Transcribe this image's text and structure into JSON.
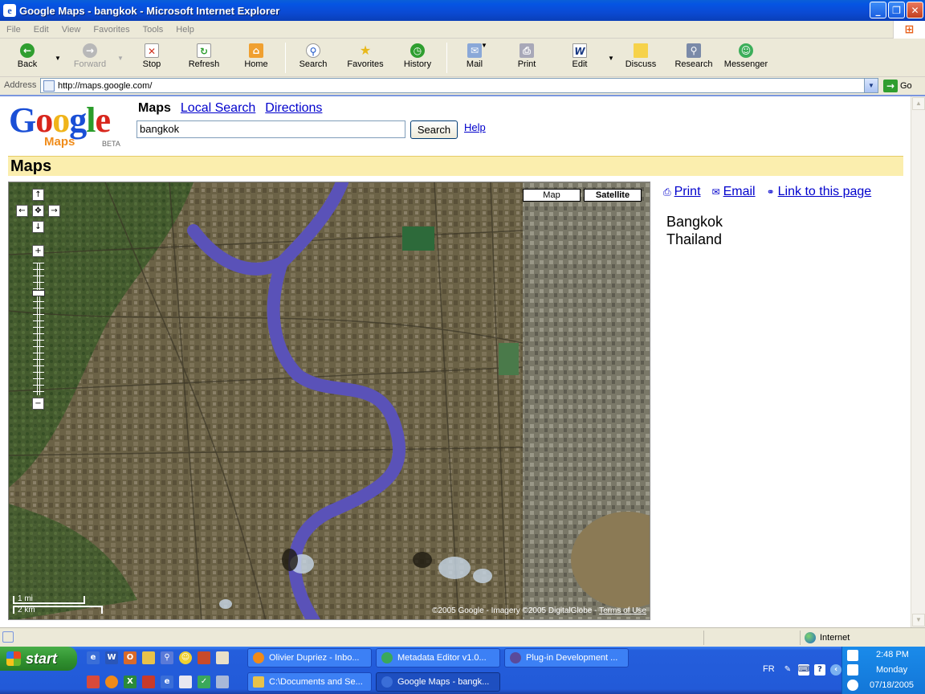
{
  "window": {
    "title": "Google Maps - bangkok - Microsoft Internet Explorer",
    "controls": {
      "minimize": "_",
      "restore": "❐",
      "close": "✕"
    }
  },
  "menu": [
    "File",
    "Edit",
    "View",
    "Favorites",
    "Tools",
    "Help"
  ],
  "toolbar": {
    "back": "Back",
    "forward": "Forward",
    "stop": "Stop",
    "refresh": "Refresh",
    "home": "Home",
    "search": "Search",
    "favorites": "Favorites",
    "history": "History",
    "mail": "Mail",
    "print": "Print",
    "edit": "Edit",
    "discuss": "Discuss",
    "research": "Research",
    "messenger": "Messenger"
  },
  "address": {
    "label": "Address",
    "url": "http://maps.google.com/",
    "go": "Go"
  },
  "page": {
    "logo": {
      "word": [
        "G",
        "o",
        "o",
        "g",
        "l",
        "e"
      ],
      "sub": "Maps",
      "beta": "BETA"
    },
    "nav": {
      "maps": "Maps",
      "local_search": "Local Search",
      "directions": "Directions"
    },
    "search": {
      "value": "bangkok",
      "button": "Search",
      "help": "Help"
    },
    "section_title": "Maps",
    "map": {
      "type_map": "Map",
      "type_satellite": "Satellite",
      "selected_type": "Satellite",
      "scale_mi": "1 mi",
      "scale_km": "2 km",
      "copyright": "©2005 Google - Imagery ©2005 DigitalGlobe -",
      "terms": "Terms of Use"
    },
    "actions": {
      "print": "Print",
      "email": "Email",
      "link": "Link to this page"
    },
    "place": {
      "city": "Bangkok",
      "country": "Thailand"
    }
  },
  "statusbar": {
    "zone": "Internet"
  },
  "taskbar": {
    "start": "start",
    "tasks_top": [
      "Olivier Dupriez - Inbo...",
      "Metadata Editor v1.0...",
      "Plug-in Development ..."
    ],
    "tasks_bottom": [
      "C:\\Documents and Se...",
      "Google Maps - bangk..."
    ],
    "lang": "FR",
    "time": "2:48 PM",
    "day": "Monday",
    "date": "07/18/2005"
  },
  "colors": {
    "river": "#5a52b8",
    "map_bg": "#5a5a3c",
    "highlight_bar": "#fbeeae",
    "link": "#0000cc"
  }
}
